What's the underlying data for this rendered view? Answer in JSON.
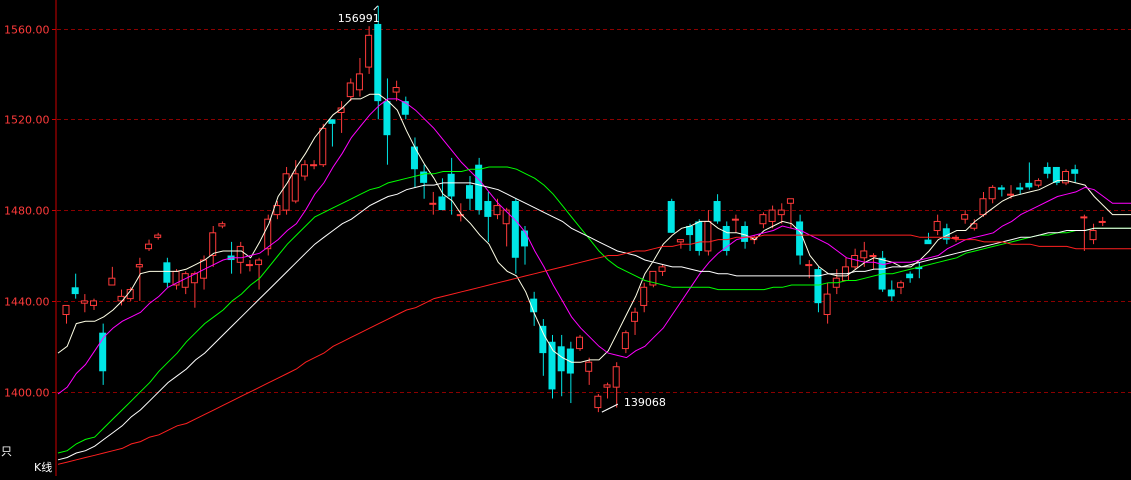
{
  "chart_data": {
    "type": "candlestick",
    "y_ticks": [
      1560.0,
      1520.0,
      1480.0,
      1440.0,
      1400.0
    ],
    "y_tick_labels": [
      "1560.00",
      "1520.00",
      "1480.00",
      "1440.00",
      "1400.00"
    ],
    "ylim": [
      1367,
      1570
    ],
    "grid": true,
    "bottom_label": "K线",
    "corner_label": "只",
    "annotations": {
      "high": "156991",
      "low": "139068"
    },
    "colors": {
      "up": "#ff3b3b",
      "down": "#00e5e5",
      "grid": "#8b0000",
      "axis": "#cc0000"
    },
    "candles": [
      [
        1434,
        1438,
        1438,
        1430
      ],
      [
        1446,
        1443,
        1452,
        1441
      ],
      [
        1439,
        1440,
        1443,
        1435
      ],
      [
        1438,
        1440,
        1441,
        1436
      ],
      [
        1426,
        1409,
        1430,
        1403
      ],
      [
        1447,
        1450,
        1455,
        1447
      ],
      [
        1440,
        1442,
        1445,
        1438
      ],
      [
        1441,
        1445,
        1446,
        1440
      ],
      [
        1455,
        1456,
        1459,
        1440
      ],
      [
        1463,
        1465,
        1467,
        1462
      ],
      [
        1468,
        1469,
        1470,
        1467
      ],
      [
        1457,
        1448,
        1459,
        1446
      ],
      [
        1447,
        1453,
        1454,
        1445
      ],
      [
        1446,
        1452,
        1453,
        1443
      ],
      [
        1448,
        1452,
        1453,
        1437
      ],
      [
        1450,
        1458,
        1460,
        1445
      ],
      [
        1460,
        1470,
        1473,
        1455
      ],
      [
        1473,
        1474,
        1475,
        1472
      ],
      [
        1460,
        1458,
        1466,
        1452
      ],
      [
        1457,
        1464,
        1466,
        1452
      ],
      [
        1456,
        1456,
        1458,
        1453
      ],
      [
        1456,
        1458,
        1459,
        1445
      ],
      [
        1463,
        1476,
        1478,
        1460
      ],
      [
        1478,
        1482,
        1484,
        1476
      ],
      [
        1480,
        1496,
        1499,
        1478
      ],
      [
        1484,
        1496,
        1502,
        1483
      ],
      [
        1495,
        1500,
        1502,
        1493
      ],
      [
        1500,
        1500,
        1502,
        1498
      ],
      [
        1500,
        1516,
        1518,
        1499
      ],
      [
        1520,
        1518,
        1520,
        1508
      ],
      [
        1523,
        1525,
        1528,
        1514
      ],
      [
        1530,
        1536,
        1538,
        1528
      ],
      [
        1533,
        1540,
        1547,
        1530
      ],
      [
        1543,
        1557,
        1561,
        1540
      ],
      [
        1562,
        1528,
        1570,
        1520
      ],
      [
        1528,
        1513,
        1538,
        1500
      ],
      [
        1532,
        1534,
        1537,
        1528
      ],
      [
        1528,
        1522,
        1530,
        1520
      ],
      [
        1508,
        1498,
        1512,
        1490
      ],
      [
        1497,
        1492,
        1500,
        1485
      ],
      [
        1483,
        1483,
        1488,
        1478
      ],
      [
        1486,
        1480,
        1494,
        1480
      ],
      [
        1496,
        1486,
        1503,
        1478
      ],
      [
        1478,
        1478,
        1483,
        1475
      ],
      [
        1491,
        1485,
        1495,
        1480
      ],
      [
        1500,
        1480,
        1503,
        1478
      ],
      [
        1484,
        1477,
        1488,
        1466
      ],
      [
        1478,
        1482,
        1485,
        1476
      ],
      [
        1474,
        1480,
        1481,
        1464
      ],
      [
        1484,
        1459,
        1485,
        1452
      ],
      [
        1471,
        1464,
        1473,
        1456
      ],
      [
        1441,
        1435,
        1444,
        1429
      ],
      [
        1429,
        1417,
        1432,
        1407
      ],
      [
        1422,
        1401,
        1425,
        1397
      ],
      [
        1420,
        1409,
        1425,
        1398
      ],
      [
        1419,
        1408,
        1422,
        1395
      ],
      [
        1419,
        1424,
        1425,
        1418
      ],
      [
        1409,
        1413,
        1415,
        1403
      ],
      [
        1393,
        1398,
        1399,
        1391
      ],
      [
        1402,
        1403,
        1404,
        1397
      ],
      [
        1402,
        1411,
        1413,
        1393
      ],
      [
        1419,
        1426,
        1427,
        1417
      ],
      [
        1431,
        1435,
        1437,
        1425
      ],
      [
        1438,
        1446,
        1448,
        1435
      ],
      [
        1447,
        1453,
        1453,
        1446
      ],
      [
        1453,
        1455,
        1456,
        1451
      ],
      [
        1484,
        1470,
        1485,
        1470
      ],
      [
        1466,
        1467,
        1467,
        1463
      ],
      [
        1473,
        1469,
        1474,
        1462
      ],
      [
        1475,
        1462,
        1476,
        1460
      ],
      [
        1462,
        1475,
        1480,
        1460
      ],
      [
        1484,
        1475,
        1487,
        1474
      ],
      [
        1473,
        1462,
        1475,
        1460
      ],
      [
        1476,
        1476,
        1478,
        1470
      ],
      [
        1473,
        1466,
        1475,
        1463
      ],
      [
        1467,
        1468,
        1469,
        1465
      ],
      [
        1474,
        1478,
        1479,
        1472
      ],
      [
        1475,
        1480,
        1482,
        1472
      ],
      [
        1478,
        1480,
        1483,
        1474
      ],
      [
        1483,
        1485,
        1485,
        1472
      ],
      [
        1475,
        1460,
        1478,
        1456
      ],
      [
        1456,
        1456,
        1458,
        1450
      ],
      [
        1454,
        1439,
        1455,
        1435
      ],
      [
        1434,
        1443,
        1448,
        1430
      ],
      [
        1446,
        1450,
        1454,
        1443
      ],
      [
        1449,
        1455,
        1459,
        1449
      ],
      [
        1455,
        1460,
        1463,
        1454
      ],
      [
        1459,
        1462,
        1466,
        1455
      ],
      [
        1460,
        1460,
        1461,
        1454
      ],
      [
        1459,
        1445,
        1462,
        1444
      ],
      [
        1445,
        1442,
        1449,
        1440
      ],
      [
        1446,
        1448,
        1449,
        1443
      ],
      [
        1452,
        1450,
        1453,
        1448
      ],
      [
        1455,
        1454,
        1457,
        1450
      ],
      [
        1467,
        1465,
        1470,
        1466
      ],
      [
        1471,
        1475,
        1478,
        1469
      ],
      [
        1472,
        1467,
        1474,
        1465
      ],
      [
        1468,
        1468,
        1469,
        1466
      ],
      [
        1476,
        1478,
        1480,
        1474
      ],
      [
        1472,
        1474,
        1476,
        1471
      ],
      [
        1478,
        1485,
        1488,
        1477
      ],
      [
        1485,
        1490,
        1491,
        1483
      ],
      [
        1490,
        1489,
        1491,
        1486
      ],
      [
        1487,
        1487,
        1491,
        1485
      ],
      [
        1490,
        1489,
        1492,
        1487
      ],
      [
        1492,
        1490,
        1501,
        1489
      ],
      [
        1491,
        1493,
        1494,
        1490
      ],
      [
        1499,
        1496,
        1501,
        1494
      ],
      [
        1499,
        1492,
        1499,
        1491
      ],
      [
        1492,
        1497,
        1498,
        1491
      ],
      [
        1498,
        1496,
        1500,
        1492
      ],
      [
        1477,
        1477,
        1478,
        1462
      ],
      [
        1467,
        1471,
        1474,
        1465
      ],
      [
        1475,
        1475,
        1477,
        1473
      ]
    ],
    "series": [
      {
        "color": "#ffffe6",
        "values": [
          1417,
          1420,
          1430,
          1431,
          1431,
          1433,
          1436,
          1440,
          1445,
          1452,
          1453,
          1453,
          1453,
          1453,
          1454,
          1456,
          1458,
          1461,
          1462,
          1462,
          1462,
          1459,
          1466,
          1474,
          1486,
          1492,
          1499,
          1505,
          1512,
          1517,
          1522,
          1525,
          1529,
          1529,
          1531,
          1531,
          1528,
          1524,
          1515,
          1507,
          1500,
          1494,
          1487,
          1484,
          1478,
          1474,
          1469,
          1465,
          1457,
          1453,
          1451,
          1444,
          1434,
          1425,
          1418,
          1415,
          1413,
          1413,
          1414,
          1414,
          1418,
          1426,
          1434,
          1442,
          1452,
          1458,
          1465,
          1469,
          1472,
          1473,
          1475,
          1475,
          1472,
          1470,
          1470,
          1469,
          1467,
          1471,
          1473,
          1475,
          1474,
          1470,
          1460,
          1455,
          1452,
          1451,
          1451,
          1454,
          1457,
          1459,
          1458,
          1457,
          1455,
          1455,
          1458,
          1462,
          1467,
          1469,
          1471,
          1471,
          1475,
          1478,
          1481,
          1484,
          1486,
          1487,
          1488,
          1489,
          1491,
          1493,
          1493,
          1492,
          1491,
          1486,
          1482,
          1478
        ]
      },
      {
        "color": "#ff00ff",
        "values": [
          1399,
          1402,
          1408,
          1412,
          1418,
          1424,
          1428,
          1431,
          1433,
          1435,
          1439,
          1442,
          1446,
          1448,
          1450,
          1452,
          1454,
          1456,
          1458,
          1459,
          1459,
          1460,
          1461,
          1464,
          1467,
          1471,
          1474,
          1480,
          1487,
          1492,
          1499,
          1505,
          1512,
          1517,
          1522,
          1526,
          1529,
          1529,
          1527,
          1524,
          1520,
          1516,
          1511,
          1506,
          1501,
          1497,
          1493,
          1488,
          1483,
          1479,
          1475,
          1470,
          1462,
          1455,
          1447,
          1440,
          1433,
          1428,
          1424,
          1420,
          1417,
          1416,
          1415,
          1418,
          1420,
          1424,
          1428,
          1434,
          1440,
          1446,
          1452,
          1457,
          1461,
          1464,
          1467,
          1468,
          1469,
          1470,
          1471,
          1473,
          1472,
          1471,
          1469,
          1467,
          1465,
          1462,
          1459,
          1458,
          1457,
          1457,
          1456,
          1457,
          1457,
          1457,
          1458,
          1459,
          1460,
          1463,
          1465,
          1467,
          1468,
          1469,
          1470,
          1473,
          1475,
          1478,
          1480,
          1482,
          1484,
          1486,
          1487,
          1488,
          1490,
          1489,
          1486,
          1483
        ]
      },
      {
        "color": "#00ff00",
        "values": [
          1373,
          1374,
          1377,
          1379,
          1380,
          1384,
          1388,
          1392,
          1396,
          1400,
          1404,
          1409,
          1413,
          1417,
          1422,
          1426,
          1430,
          1433,
          1436,
          1440,
          1443,
          1447,
          1450,
          1455,
          1460,
          1465,
          1469,
          1473,
          1477,
          1479,
          1481,
          1483,
          1485,
          1487,
          1489,
          1490,
          1492,
          1493,
          1494,
          1495,
          1496,
          1496,
          1497,
          1497,
          1497,
          1498,
          1498,
          1499,
          1499,
          1499,
          1498,
          1496,
          1494,
          1491,
          1487,
          1482,
          1477,
          1472,
          1467,
          1462,
          1458,
          1455,
          1453,
          1451,
          1449,
          1448,
          1447,
          1446,
          1446,
          1446,
          1446,
          1446,
          1445,
          1445,
          1445,
          1445,
          1445,
          1445,
          1446,
          1446,
          1447,
          1447,
          1447,
          1447,
          1448,
          1448,
          1449,
          1449,
          1450,
          1451,
          1452,
          1452,
          1453,
          1454,
          1455,
          1456,
          1457,
          1458,
          1459,
          1461,
          1462,
          1463,
          1464,
          1465,
          1466,
          1467,
          1468,
          1469,
          1469,
          1470,
          1470,
          1471,
          1471,
          1472
        ]
      },
      {
        "color": "#ffffff",
        "values": [
          1370,
          1371,
          1373,
          1374,
          1376,
          1379,
          1382,
          1385,
          1389,
          1392,
          1396,
          1400,
          1404,
          1407,
          1410,
          1414,
          1417,
          1421,
          1425,
          1429,
          1433,
          1437,
          1441,
          1445,
          1449,
          1453,
          1457,
          1461,
          1465,
          1468,
          1471,
          1474,
          1476,
          1479,
          1482,
          1484,
          1486,
          1487,
          1489,
          1490,
          1491,
          1491,
          1492,
          1492,
          1492,
          1492,
          1491,
          1490,
          1489,
          1487,
          1485,
          1483,
          1481,
          1479,
          1477,
          1475,
          1472,
          1470,
          1468,
          1466,
          1464,
          1462,
          1461,
          1460,
          1458,
          1457,
          1456,
          1455,
          1455,
          1454,
          1453,
          1453,
          1452,
          1452,
          1451,
          1451,
          1451,
          1451,
          1451,
          1451,
          1451,
          1451,
          1451,
          1451,
          1452,
          1452,
          1452,
          1453,
          1453,
          1454,
          1454,
          1455,
          1455,
          1456,
          1457,
          1458,
          1459,
          1460,
          1461,
          1462,
          1463,
          1464,
          1465,
          1466,
          1467,
          1468,
          1468,
          1469,
          1470,
          1470,
          1471,
          1471,
          1471,
          1472
        ]
      },
      {
        "color": "#ff2020",
        "values": [
          1368,
          1369,
          1370,
          1371,
          1372,
          1373,
          1374,
          1375,
          1377,
          1378,
          1380,
          1381,
          1383,
          1385,
          1386,
          1388,
          1390,
          1392,
          1394,
          1396,
          1398,
          1400,
          1402,
          1404,
          1406,
          1408,
          1410,
          1413,
          1415,
          1417,
          1420,
          1422,
          1424,
          1426,
          1428,
          1430,
          1432,
          1434,
          1436,
          1437,
          1439,
          1441,
          1442,
          1443,
          1444,
          1445,
          1446,
          1447,
          1448,
          1449,
          1450,
          1451,
          1452,
          1453,
          1454,
          1455,
          1456,
          1457,
          1458,
          1459,
          1460,
          1460,
          1461,
          1462,
          1462,
          1463,
          1464,
          1464,
          1465,
          1465,
          1466,
          1466,
          1467,
          1467,
          1468,
          1468,
          1468,
          1469,
          1469,
          1469,
          1469,
          1469,
          1469,
          1469,
          1469,
          1469,
          1469,
          1469,
          1469,
          1469,
          1469,
          1469,
          1469,
          1469,
          1468,
          1468,
          1468,
          1468,
          1467,
          1467,
          1467,
          1466,
          1466,
          1466,
          1465,
          1465,
          1465,
          1464,
          1464,
          1464,
          1464,
          1463,
          1463,
          1463
        ]
      }
    ]
  }
}
